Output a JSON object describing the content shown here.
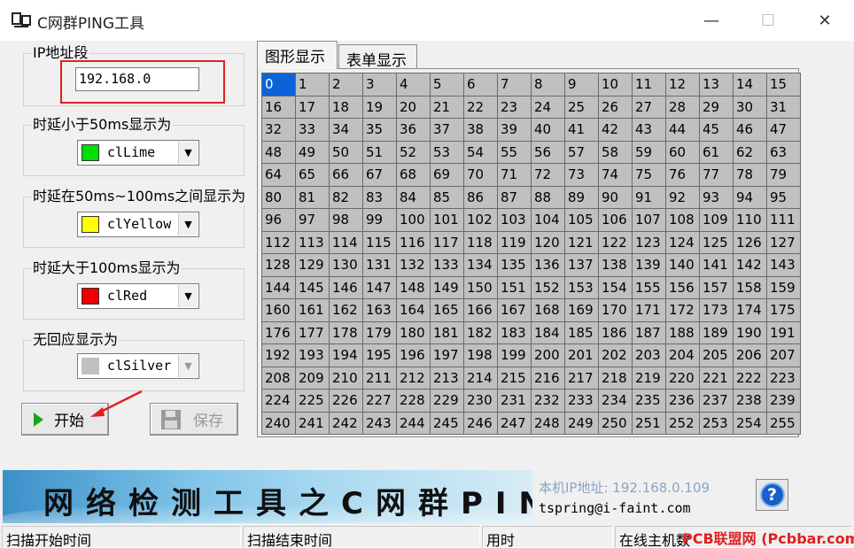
{
  "window": {
    "title": "C网群PING工具"
  },
  "ip_group": {
    "label": "IP地址段",
    "value": "192.168.0"
  },
  "color_groups": [
    {
      "label": "时延小于50ms显示为",
      "value": "clLime",
      "color": "#00e000",
      "disabled": false
    },
    {
      "label": "时延在50ms~100ms之间显示为",
      "value": "clYellow",
      "color": "#ffff00",
      "disabled": false
    },
    {
      "label": "时延大于100ms显示为",
      "value": "clRed",
      "color": "#ee0000",
      "disabled": false
    },
    {
      "label": "无回应显示为",
      "value": "clSilver",
      "color": "#c0c0c0",
      "disabled": true
    }
  ],
  "buttons": {
    "start": "开始",
    "save": "保存"
  },
  "tabs": [
    {
      "label": "图形显示"
    },
    {
      "label": "表单显示"
    }
  ],
  "grid": {
    "start": 0,
    "end": 255,
    "selected": 0
  },
  "banner": {
    "text": "网络检测工具之C网群PING"
  },
  "info": {
    "local_ip": "本机IP地址: 192.168.0.109",
    "email": "tspring@i-faint.com",
    "help": "?"
  },
  "status": [
    "扫描开始时间",
    "扫描结束时间",
    "用时",
    "在线主机数"
  ],
  "watermark": "PCB联盟网 (Pcbbar.com)"
}
